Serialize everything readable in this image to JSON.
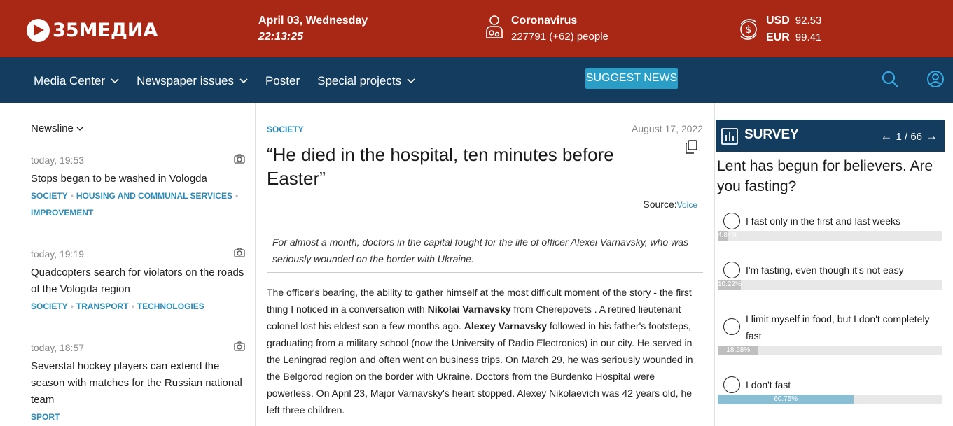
{
  "header": {
    "logo_text": "35МЕДИА",
    "date": "April 03, Wednesday",
    "time": "22:13:25",
    "covid": {
      "title": "Coronavirus",
      "count": "227791 (+62) people"
    },
    "currency": [
      {
        "code": "USD",
        "value": "92.53"
      },
      {
        "code": "EUR",
        "value": "99.41"
      }
    ]
  },
  "nav": {
    "items": [
      {
        "label": "Media Center",
        "dropdown": true
      },
      {
        "label": "Newspaper issues",
        "dropdown": true
      },
      {
        "label": "Poster",
        "dropdown": false
      },
      {
        "label": "Special projects",
        "dropdown": true
      }
    ],
    "suggest_label": "SUGGEST NEWS"
  },
  "newsline": {
    "title": "Newsline",
    "items": [
      {
        "time": "today, 19:53",
        "title": "Stops began to be washed in Vologda",
        "tags": [
          "SOCIETY",
          "HOUSING AND COMMUNAL SERVICES",
          "IMPROVEMENT"
        ]
      },
      {
        "time": "today, 19:19",
        "title": "Quadcopters search for violators on the roads of the Vologda region",
        "tags": [
          "SOCIETY",
          "TRANSPORT",
          "TECHNOLOGIES"
        ]
      },
      {
        "time": "today, 18:57",
        "title": "Severstal hockey players can extend the season with matches for the Russian national team",
        "tags": [
          "SPORT"
        ]
      }
    ]
  },
  "article": {
    "section": "SOCIETY",
    "date": "August 17, 2022",
    "title": "“He died in the hospital, ten minutes before Easter”",
    "source_label": "Source:",
    "source_value": "Voice",
    "lead": "For almost a month, doctors in the capital fought for the life of officer Alexei Varnavsky, who was seriously wounded on the border with Ukraine.",
    "body": {
      "p1": "The officer's bearing, the ability to gather himself at the most difficult moment of the story - the first thing I noticed in a conversation with ",
      "b1": "Nikolai Varnavsky",
      "p2": " from Cherepovets . A retired lieutenant colonel lost his eldest son a few months ago. ",
      "b2": "Alexey Varnavsky",
      "p3": " followed in his father's footsteps, graduating from a military school (now the University of Radio Electronics) in our city. He served in the Leningrad region and often went on business trips. On March 29, he was seriously wounded in the Belgorod region on the border with Ukraine. Doctors from the Burdenko Hospital were powerless. On April 23, Major Varnavsky's heart stopped. Alexey Nikolaevich was 42 years old, he left three children."
    }
  },
  "survey": {
    "label": "SURVEY",
    "pager": "1 / 66",
    "question": "Lent has begun for believers. Are you fasting?",
    "options": [
      {
        "label": "I fast only in the first and last weeks",
        "percent": "4.84%",
        "value": 4.84
      },
      {
        "label": "I'm fasting, even though it's not easy",
        "percent": "10.22%",
        "value": 10.22
      },
      {
        "label": "I limit myself in food, but I don't completely fast",
        "percent": "18.28%",
        "value": 18.28
      },
      {
        "label": "I don't fast",
        "percent": "60.75%",
        "value": 60.75
      }
    ]
  },
  "colors": {
    "brand_red": "#a92815",
    "nav_blue": "#143c5e",
    "accent": "#2a9ec7"
  }
}
